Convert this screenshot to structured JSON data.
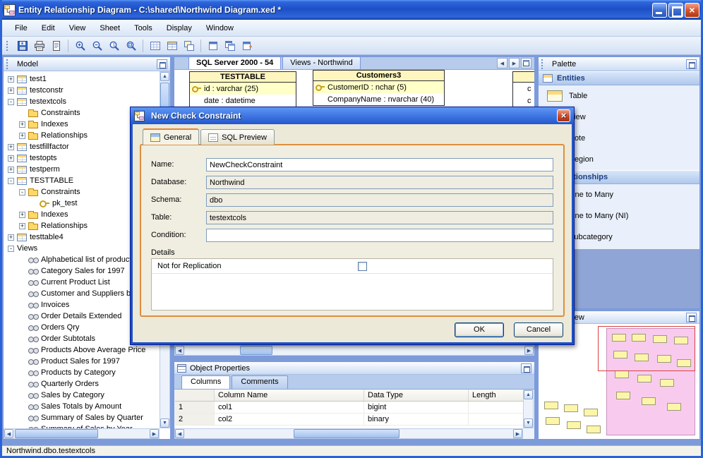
{
  "window": {
    "title": "Entity Relationship Diagram - C:\\shared\\Northwind Diagram.xed *",
    "status_text": "Northwind.dbo.testextcols"
  },
  "menu": {
    "items": [
      "File",
      "Edit",
      "View",
      "Sheet",
      "Tools",
      "Display",
      "Window"
    ]
  },
  "toolbar": {
    "icons": [
      "save",
      "print",
      "print-preview",
      "zoom-in",
      "zoom-out",
      "zoom-normal",
      "zoom-fit",
      "grid",
      "table-header-display",
      "overlap-tables",
      "sheet",
      "sheets",
      "sheet-add"
    ]
  },
  "model": {
    "title": "Model",
    "tree": [
      {
        "exp": "+",
        "icon": "table",
        "label": "test1",
        "indent": 0
      },
      {
        "exp": "+",
        "icon": "table",
        "label": "testconstr",
        "indent": 0
      },
      {
        "exp": "-",
        "icon": "table",
        "label": "testextcols",
        "indent": 0
      },
      {
        "exp": "",
        "icon": "folder",
        "label": "Constraints",
        "indent": 1
      },
      {
        "exp": "+",
        "icon": "folder",
        "label": "Indexes",
        "indent": 1
      },
      {
        "exp": "+",
        "icon": "folder",
        "label": "Relationships",
        "indent": 1
      },
      {
        "exp": "+",
        "icon": "table",
        "label": "testfillfactor",
        "indent": 0
      },
      {
        "exp": "+",
        "icon": "table",
        "label": "testopts",
        "indent": 0
      },
      {
        "exp": "+",
        "icon": "table",
        "label": "testperm",
        "indent": 0
      },
      {
        "exp": "-",
        "icon": "table",
        "label": "TESTTABLE",
        "indent": 0
      },
      {
        "exp": "-",
        "icon": "folder",
        "label": "Constraints",
        "indent": 1
      },
      {
        "exp": "",
        "icon": "key",
        "label": "pk_test",
        "indent": 2
      },
      {
        "exp": "+",
        "icon": "folder",
        "label": "Indexes",
        "indent": 1
      },
      {
        "exp": "+",
        "icon": "folder",
        "label": "Relationships",
        "indent": 1
      },
      {
        "exp": "+",
        "icon": "table",
        "label": "testtable4",
        "indent": 0
      },
      {
        "exp": "-",
        "icon": "none",
        "label": "Views",
        "indent": 0
      },
      {
        "exp": "",
        "icon": "view",
        "label": "Alphabetical list of products",
        "indent": 1
      },
      {
        "exp": "",
        "icon": "view",
        "label": "Category Sales for 1997",
        "indent": 1
      },
      {
        "exp": "",
        "icon": "view",
        "label": "Current Product List",
        "indent": 1
      },
      {
        "exp": "",
        "icon": "view",
        "label": "Customer and Suppliers by City",
        "indent": 1
      },
      {
        "exp": "",
        "icon": "view",
        "label": "Invoices",
        "indent": 1
      },
      {
        "exp": "",
        "icon": "view",
        "label": "Order Details Extended",
        "indent": 1
      },
      {
        "exp": "",
        "icon": "view",
        "label": "Orders Qry",
        "indent": 1
      },
      {
        "exp": "",
        "icon": "view",
        "label": "Order Subtotals",
        "indent": 1
      },
      {
        "exp": "",
        "icon": "view",
        "label": "Products Above Average Price",
        "indent": 1
      },
      {
        "exp": "",
        "icon": "view",
        "label": "Product Sales for 1997",
        "indent": 1
      },
      {
        "exp": "",
        "icon": "view",
        "label": "Products by Category",
        "indent": 1
      },
      {
        "exp": "",
        "icon": "view",
        "label": "Quarterly Orders",
        "indent": 1
      },
      {
        "exp": "",
        "icon": "view",
        "label": "Sales by Category",
        "indent": 1
      },
      {
        "exp": "",
        "icon": "view",
        "label": "Sales Totals by Amount",
        "indent": 1
      },
      {
        "exp": "",
        "icon": "view",
        "label": "Summary of Sales by Quarter",
        "indent": 1
      },
      {
        "exp": "",
        "icon": "view",
        "label": "Summary of Sales by Year",
        "indent": 1
      }
    ]
  },
  "diagram": {
    "tabs": [
      {
        "label": "SQL Server 2000 - 54",
        "selected": true
      },
      {
        "label": "Views - Northwind",
        "selected": false
      }
    ],
    "entities": [
      {
        "name": "TESTTABLE",
        "rows": [
          {
            "text": "id : varchar (25)",
            "key": true
          },
          {
            "text": "date : datetime",
            "key": false
          }
        ]
      },
      {
        "name": "Customers3",
        "rows": [
          {
            "text": "CustomerID : nchar (5)",
            "key": true
          },
          {
            "text": "CompanyName : nvarchar (40)",
            "key": false
          }
        ]
      },
      {
        "name": "",
        "rows": [
          {
            "text": "c",
            "key": false
          },
          {
            "text": "c",
            "key": false
          }
        ]
      }
    ]
  },
  "dialog": {
    "title": "New Check Constraint",
    "tabs": [
      {
        "label": "General",
        "selected": true,
        "icon": "general-tab"
      },
      {
        "label": "SQL Preview",
        "selected": false,
        "icon": "sql-tab"
      }
    ],
    "fields": [
      {
        "label": "Name:",
        "value": "NewCheckConstraint",
        "ro": "false"
      },
      {
        "label": "Database:",
        "value": "Northwind",
        "ro": "true"
      },
      {
        "label": "Schema:",
        "value": "dbo",
        "ro": "true"
      },
      {
        "label": "Table:",
        "value": "testextcols",
        "ro": "true"
      },
      {
        "label": "Condition:",
        "value": "",
        "ro": "false"
      }
    ],
    "details_label": "Details",
    "replication_label": "Not for Replication",
    "ok_label": "OK",
    "cancel_label": "Cancel"
  },
  "palette": {
    "title": "Palette",
    "entities_header": "Entities",
    "entities": [
      {
        "label": "Table",
        "icon": "table"
      },
      {
        "label": "View",
        "icon": "view"
      },
      {
        "label": "Note",
        "icon": "note"
      },
      {
        "label": "Region",
        "icon": "region"
      }
    ],
    "relationships_header": "Relationships",
    "relationships": [
      {
        "label": "One to Many",
        "icon": "one-to-many"
      },
      {
        "label": "One to Many (NI)",
        "icon": "one-to-many-ni"
      },
      {
        "label": "Subcategory",
        "icon": "subcategory"
      }
    ]
  },
  "overview": {
    "title": "Overview"
  },
  "properties": {
    "title": "Object Properties",
    "tabs": [
      {
        "label": "Columns",
        "selected": true
      },
      {
        "label": "Comments",
        "selected": false
      }
    ],
    "columns": [
      "Column Name",
      "Data Type",
      "Length"
    ],
    "rows": [
      {
        "num": "1",
        "name": "col1",
        "type": "bigint",
        "length": ""
      },
      {
        "num": "2",
        "name": "col2",
        "type": "binary",
        "length": ""
      }
    ]
  }
}
